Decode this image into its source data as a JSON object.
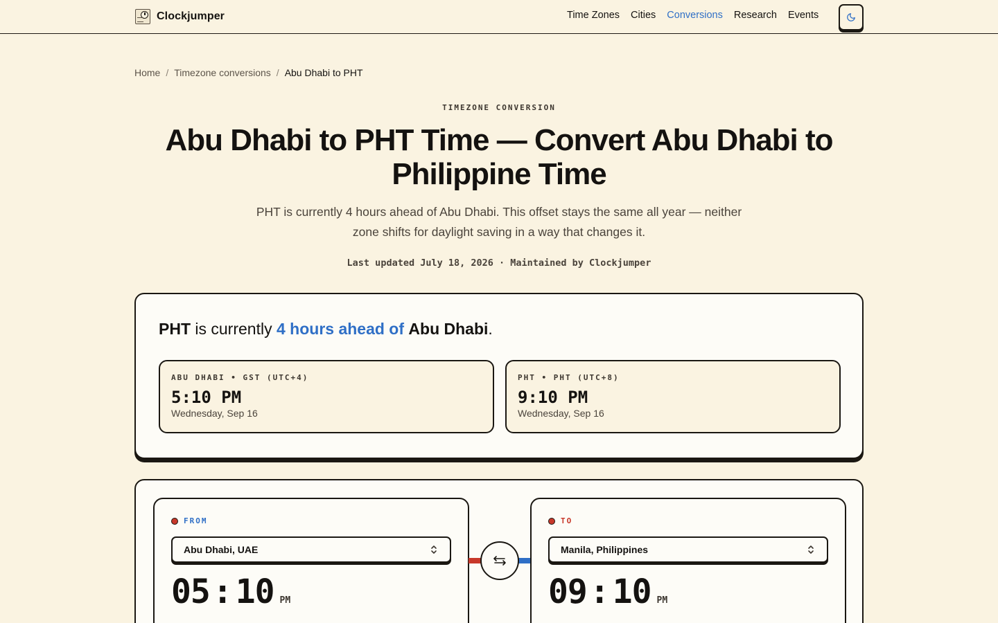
{
  "header": {
    "brand": "Clockjumper",
    "nav": [
      {
        "label": "Time Zones",
        "active": false
      },
      {
        "label": "Cities",
        "active": false
      },
      {
        "label": "Conversions",
        "active": true
      },
      {
        "label": "Research",
        "active": false
      },
      {
        "label": "Events",
        "active": false
      }
    ],
    "theme_toggle_icon": "moon-icon"
  },
  "breadcrumb": {
    "items": [
      "Home",
      "Timezone conversions",
      "Abu Dhabi to PHT"
    ],
    "separator": "/"
  },
  "hero": {
    "eyebrow": "TIMEZONE CONVERSION",
    "title": "Abu Dhabi to PHT Time — Convert Abu Dhabi to Philippine Time",
    "lede": "PHT is currently 4 hours ahead of Abu Dhabi. This offset stays the same all year — neither zone shifts for daylight saving in a way that changes it.",
    "meta": "Last updated July 18, 2026 · Maintained by Clockjumper"
  },
  "summary": {
    "target": "PHT",
    "phrase": " is currently ",
    "offset": "4 hours ahead of",
    "source": "Abu Dhabi",
    "end": ".",
    "cards": [
      {
        "label": "ABU DHABI • GST (UTC+4)",
        "time": "5:10 PM",
        "date": "Wednesday, Sep 16"
      },
      {
        "label": "PHT • PHT (UTC+8)",
        "time": "9:10 PM",
        "date": "Wednesday, Sep 16"
      }
    ]
  },
  "converter": {
    "from": {
      "label": "FROM",
      "city": "Abu Dhabi, UAE",
      "hour": "05",
      "minute": "10",
      "ampm": "PM"
    },
    "to": {
      "label": "TO",
      "city": "Manila, Philippines",
      "hour": "09",
      "minute": "10",
      "ampm": "PM"
    },
    "swap_icon": "swap-arrows-icon",
    "colors": {
      "from_accent": "#2f6fc6",
      "to_accent": "#c8382a"
    }
  }
}
